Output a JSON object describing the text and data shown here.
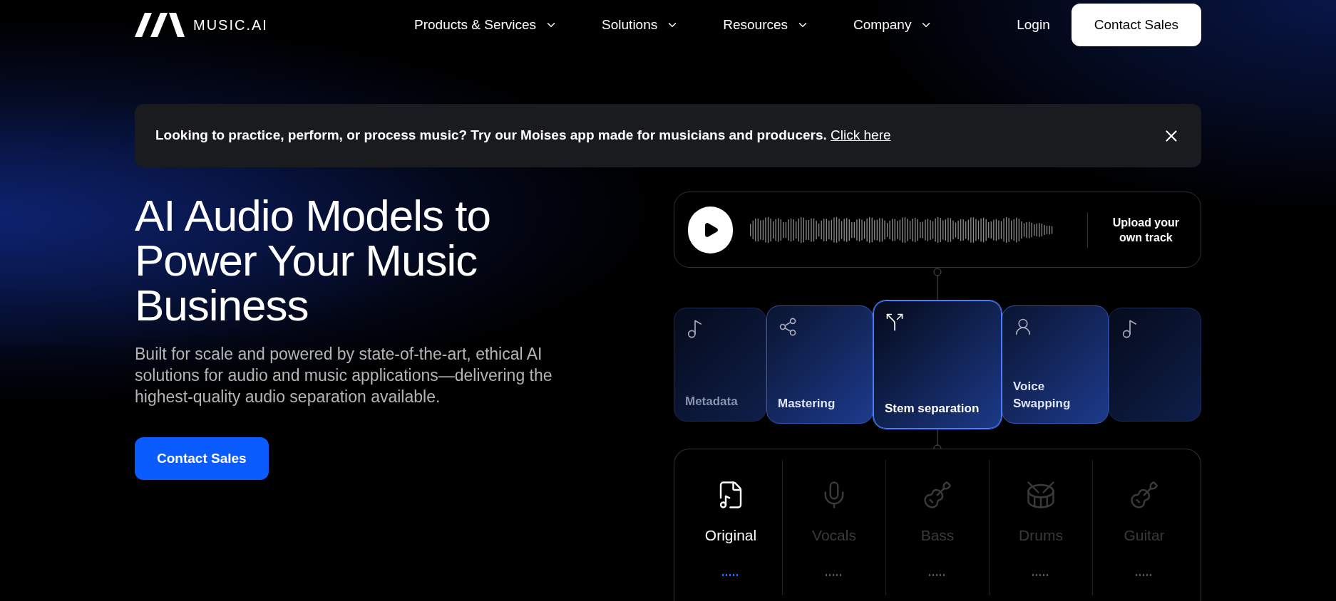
{
  "logo": {
    "text": "MUSIC.AI"
  },
  "nav": {
    "items": [
      {
        "label": "Products & Services"
      },
      {
        "label": "Solutions"
      },
      {
        "label": "Resources"
      },
      {
        "label": "Company"
      }
    ],
    "login": "Login",
    "cta": "Contact Sales"
  },
  "banner": {
    "text": "Looking to practice, perform, or process music? Try our Moises app made for musicians and producers.",
    "link": "Click here"
  },
  "hero": {
    "title": "AI Audio Models to Power Your Music Business",
    "subtitle": "Built for scale and powered by state-of-the-art, ethical AI solutions for audio and music applications—delivering the highest-quality audio separation available.",
    "cta": "Contact Sales"
  },
  "player": {
    "upload": "Upload your own track"
  },
  "models": [
    {
      "label": "Metadata",
      "selected": false,
      "kind": "far"
    },
    {
      "label": "Mastering",
      "selected": false,
      "kind": "near"
    },
    {
      "label": "Stem separation",
      "selected": true,
      "kind": "center"
    },
    {
      "label": "Voice Swapping",
      "selected": false,
      "kind": "near"
    },
    {
      "selected": false,
      "kind": "far"
    }
  ],
  "stems": [
    {
      "label": "Original",
      "selected": true,
      "kind": "file"
    },
    {
      "label": "Vocals",
      "selected": false,
      "kind": "mic"
    },
    {
      "label": "Bass",
      "selected": false,
      "kind": "bass"
    },
    {
      "label": "Drums",
      "selected": false,
      "kind": "drum"
    },
    {
      "label": "Guitar",
      "selected": false,
      "kind": "guitar"
    }
  ]
}
